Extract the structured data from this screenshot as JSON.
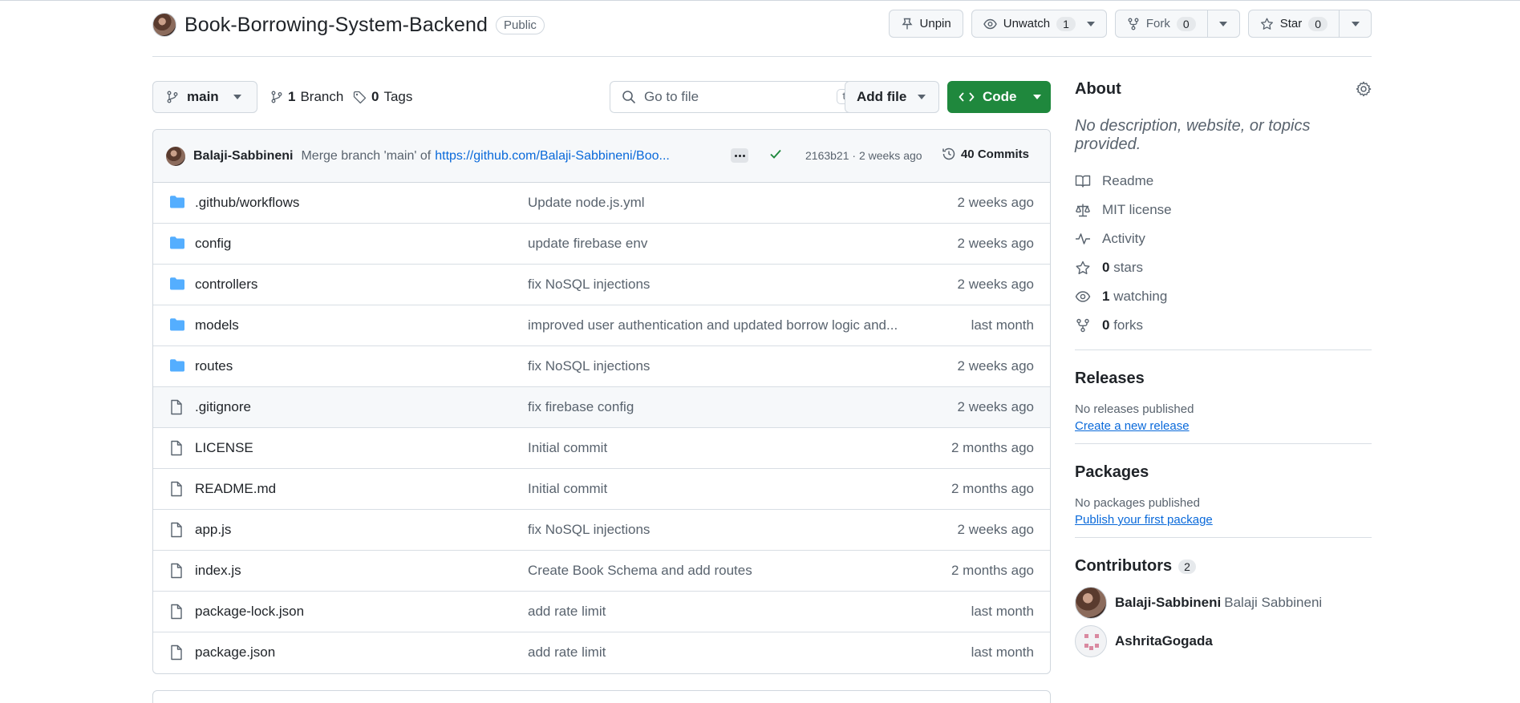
{
  "repo": {
    "name": "Book-Borrowing-System-Backend",
    "visibility": "Public"
  },
  "header_actions": {
    "unpin_label": "Unpin",
    "unwatch_label": "Unwatch",
    "watch_count": "1",
    "fork_label": "Fork",
    "fork_count": "0",
    "star_label": "Star",
    "star_count": "0"
  },
  "toolbar": {
    "branch": "main",
    "branches_count": "1",
    "branches_label": "Branch",
    "tags_count": "0",
    "tags_label": "Tags",
    "search_placeholder": "Go to file",
    "search_shortcut": "t",
    "add_file_label": "Add file",
    "code_label": "Code"
  },
  "latest_commit": {
    "author": "Balaji-Sabbineni",
    "message": "Merge branch 'main' of",
    "url_text": "https://github.com/Balaji-Sabbineni/Boo...",
    "sha_time": "2163b21 · 2 weeks ago",
    "commits_label": "40 Commits"
  },
  "files": [
    {
      "name": ".github/workflows",
      "type": "folder",
      "message": "Update node.js.yml",
      "date": "2 weeks ago"
    },
    {
      "name": "config",
      "type": "folder",
      "message": "update firebase env",
      "date": "2 weeks ago"
    },
    {
      "name": "controllers",
      "type": "folder",
      "message": "fix NoSQL injections",
      "date": "2 weeks ago"
    },
    {
      "name": "models",
      "type": "folder",
      "message": "improved user authentication and updated borrow logic and...",
      "date": "last month"
    },
    {
      "name": "routes",
      "type": "folder",
      "message": "fix NoSQL injections",
      "date": "2 weeks ago"
    },
    {
      "name": ".gitignore",
      "type": "file",
      "message": "fix firebase config",
      "date": "2 weeks ago"
    },
    {
      "name": "LICENSE",
      "type": "file",
      "message": "Initial commit",
      "date": "2 months ago"
    },
    {
      "name": "README.md",
      "type": "file",
      "message": "Initial commit",
      "date": "2 months ago"
    },
    {
      "name": "app.js",
      "type": "file",
      "message": "fix NoSQL injections",
      "date": "2 weeks ago"
    },
    {
      "name": "index.js",
      "type": "file",
      "message": "Create Book Schema and add routes",
      "date": "2 months ago"
    },
    {
      "name": "package-lock.json",
      "type": "file",
      "message": "add rate limit",
      "date": "last month"
    },
    {
      "name": "package.json",
      "type": "file",
      "message": "add rate limit",
      "date": "last month"
    }
  ],
  "about": {
    "title": "About",
    "description": "No description, website, or topics provided.",
    "readme": "Readme",
    "license": "MIT license",
    "activity": "Activity",
    "stars_count": "0",
    "stars_label": "stars",
    "watching_count": "1",
    "watching_label": "watching",
    "forks_count": "0",
    "forks_label": "forks"
  },
  "releases": {
    "title": "Releases",
    "empty": "No releases published",
    "link": "Create a new release"
  },
  "packages": {
    "title": "Packages",
    "empty": "No packages published",
    "link": "Publish your first package"
  },
  "contributors": {
    "title": "Contributors",
    "count": "2",
    "list": [
      {
        "login": "Balaji-Sabbineni",
        "full_name": "Balaji Sabbineni"
      },
      {
        "login": "AshritaGogada",
        "full_name": ""
      }
    ]
  },
  "colors": {
    "accent_green": "#1f883d",
    "link_blue": "#0969da",
    "folder_blue": "#54aeff",
    "muted_text": "#59636e"
  }
}
